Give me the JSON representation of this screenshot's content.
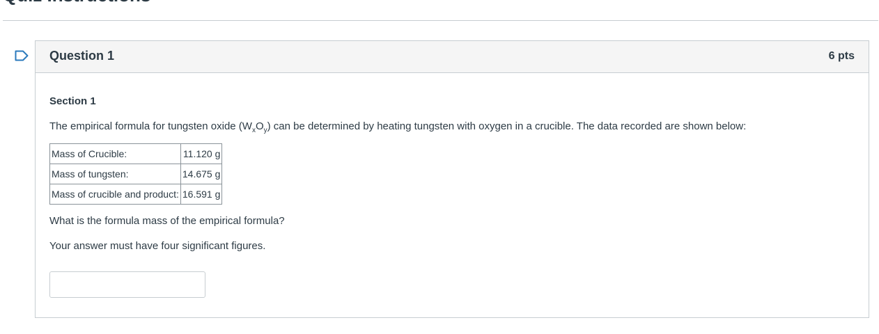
{
  "page": {
    "heading": "Quiz Instructions"
  },
  "question": {
    "title": "Question 1",
    "points": "6 pts",
    "section": "Section 1",
    "prompt_before": "The empirical formula for tungsten oxide (W",
    "prompt_sub_x": "x",
    "prompt_mid": "O",
    "prompt_sub_y": "y",
    "prompt_after": ") can be determined by heating tungsten with oxygen in a crucible. The data recorded are shown below:",
    "table": [
      {
        "label": "Mass of Crucible:",
        "value": "11.120 g"
      },
      {
        "label": "Mass of tungsten:",
        "value": "14.675 g"
      },
      {
        "label": "Mass of crucible and product:",
        "value": "16.591 g"
      }
    ],
    "ask": "What is the formula mass of the empirical formula?",
    "note": "Your answer must have four significant figures.",
    "answer_value": ""
  },
  "colors": {
    "text": "#2d3b45",
    "border": "#c7cdd1",
    "header_bg": "#f5f5f5",
    "flag": "#2b7abc"
  },
  "icons": {
    "flag": "bookmark-flag-icon"
  }
}
